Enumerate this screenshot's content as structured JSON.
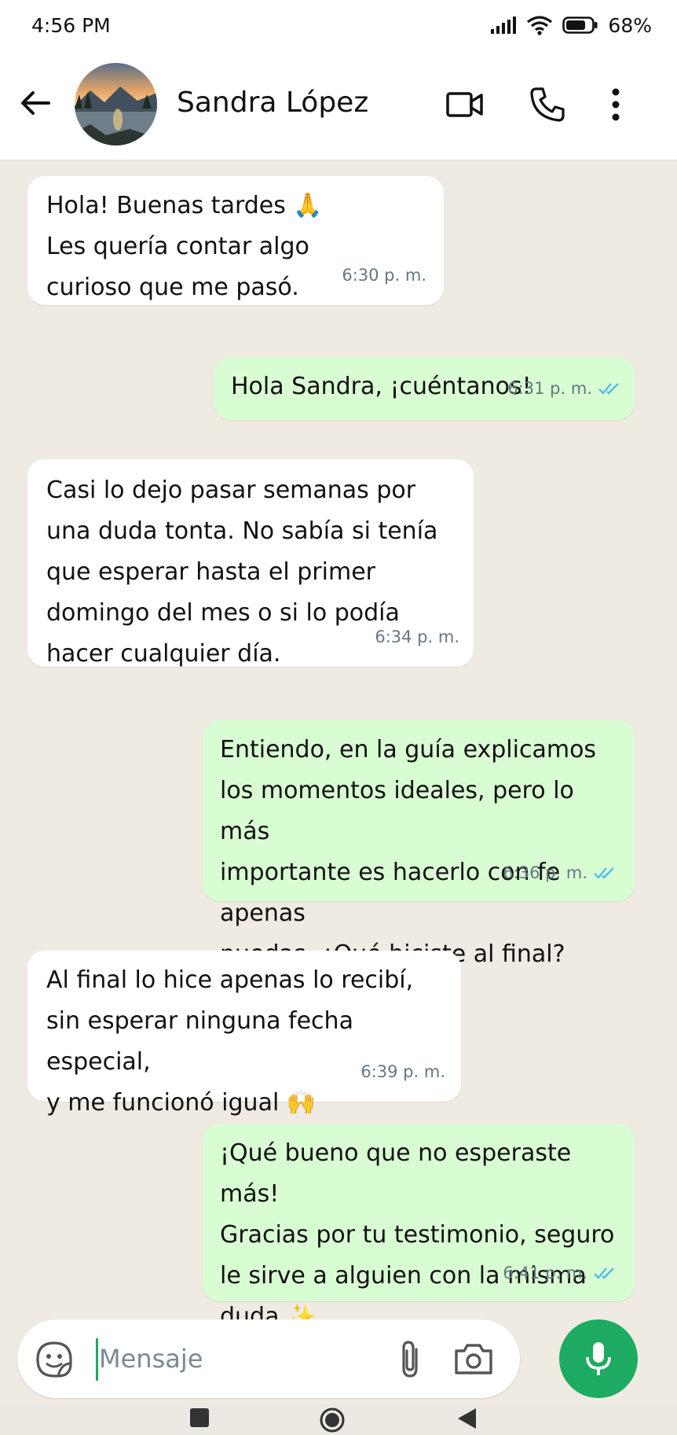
{
  "status_bar": {
    "time": "4:56 PM",
    "battery": "68%"
  },
  "header": {
    "contact_name": "Sandra López",
    "icons": [
      "back-arrow-icon",
      "video-call-icon",
      "phone-icon",
      "more-options-icon"
    ]
  },
  "messages": [
    {
      "direction": "in",
      "text": "Hola! Buenas tardes 🙏\nLes quería contar algo\ncurioso que me pasó.",
      "time": "6:30 p. m."
    },
    {
      "direction": "out",
      "text": "Hola Sandra, ¡cuéntanos!",
      "time": "6:31 p. m.",
      "status": "read"
    },
    {
      "direction": "in",
      "text": "Casi lo dejo pasar semanas por\nuna duda tonta. No sabía si tenía\nque esperar hasta el primer\ndomingo del mes o si lo podía\nhacer cualquier día.",
      "time": "6:34 p. m."
    },
    {
      "direction": "out",
      "text": "Entiendo, en la guía explicamos\nlos momentos ideales, pero lo más\nimportante es hacerlo con fe apenas\npuedas. ¿Qué hiciste al final?",
      "time": "6:36 p. m.",
      "status": "read"
    },
    {
      "direction": "in",
      "text": "Al final lo hice apenas lo recibí,\nsin esperar ninguna fecha especial,\ny me funcionó igual 🙌",
      "time": "6:39 p. m."
    },
    {
      "direction": "out",
      "text": "¡Qué bueno que no esperaste más!\nGracias por tu testimonio, seguro\nle sirve a alguien con la misma\nduda ✨",
      "time": "6:41 p. m.",
      "status": "read"
    }
  ],
  "composer": {
    "placeholder": "Mensaje",
    "value": ""
  },
  "colors": {
    "incoming_bubble": "#ffffff",
    "outgoing_bubble": "#d9fdd3",
    "chat_background": "#efeae2",
    "accent_green": "#1daa61",
    "read_ticks": "#53bdeb"
  }
}
